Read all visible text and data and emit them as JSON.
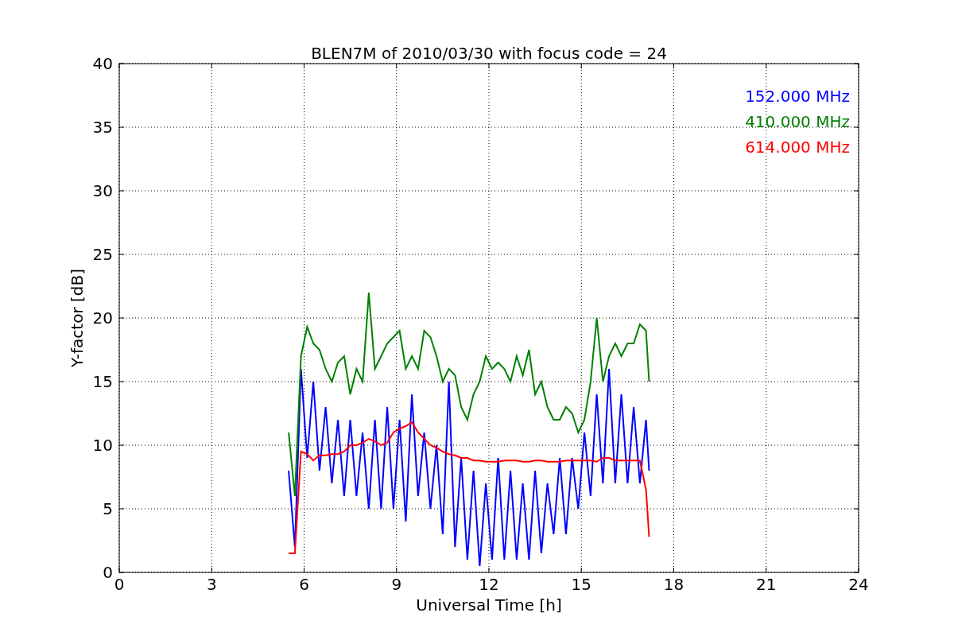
{
  "figure": {
    "chart_data": {
      "type": "line",
      "title": "BLEN7M of 2010/03/30 with focus code = 24",
      "xlabel": "Universal Time [h]",
      "ylabel": "Y-factor [dB]",
      "x": [
        5.5,
        5.7,
        5.9,
        6.1,
        6.3,
        6.5,
        6.7,
        6.9,
        7.1,
        7.3,
        7.5,
        7.7,
        7.9,
        8.1,
        8.3,
        8.5,
        8.7,
        8.9,
        9.1,
        9.3,
        9.5,
        9.7,
        9.9,
        10.1,
        10.3,
        10.5,
        10.7,
        10.9,
        11.1,
        11.3,
        11.5,
        11.7,
        11.9,
        12.1,
        12.3,
        12.5,
        12.7,
        12.9,
        13.1,
        13.3,
        13.5,
        13.7,
        13.9,
        14.1,
        14.3,
        14.5,
        14.7,
        14.9,
        15.1,
        15.3,
        15.5,
        15.7,
        15.9,
        16.1,
        16.3,
        16.5,
        16.7,
        16.9,
        17.1,
        17.2
      ],
      "series": [
        {
          "name": "152.000 MHz",
          "color": "#0000ff",
          "values": [
            8,
            2,
            16,
            9,
            15,
            8,
            13,
            7,
            12,
            6,
            12,
            6,
            11,
            5,
            12,
            5,
            13,
            5,
            12,
            4,
            14,
            6,
            11,
            5,
            10,
            3,
            15,
            2,
            9,
            1,
            8,
            0.5,
            7,
            1,
            9,
            1,
            8,
            1,
            7,
            1,
            8,
            1.5,
            7,
            3,
            9,
            3,
            9,
            5,
            11,
            6,
            14,
            7,
            16,
            7,
            14,
            7,
            13,
            7,
            12,
            8
          ]
        },
        {
          "name": "410.000 MHz",
          "color": "#008000",
          "values": [
            11,
            6,
            17,
            19.3,
            18,
            17.5,
            16,
            15,
            16.5,
            17,
            14,
            16,
            15,
            22,
            16,
            17,
            18,
            18.5,
            19,
            16,
            17,
            16,
            19,
            18.5,
            17,
            15,
            16,
            15.5,
            13,
            12,
            14,
            15,
            17,
            16,
            16.5,
            16,
            15,
            17,
            15.5,
            17.5,
            14,
            15,
            13,
            12,
            12,
            13,
            12.5,
            11,
            12,
            15,
            20,
            15,
            17,
            18,
            17,
            18,
            18,
            19.5,
            19,
            15
          ]
        },
        {
          "name": "614.000 MHz",
          "color": "#ff0000",
          "values": [
            1.5,
            1.5,
            9.5,
            9.3,
            8.8,
            9.2,
            9.2,
            9.3,
            9.3,
            9.5,
            10,
            10,
            10.2,
            10.5,
            10.3,
            10,
            10.2,
            11,
            11.3,
            11.5,
            11.8,
            11,
            10.5,
            10,
            9.8,
            9.5,
            9.3,
            9.2,
            9,
            9,
            8.8,
            8.8,
            8.7,
            8.7,
            8.7,
            8.8,
            8.8,
            8.8,
            8.7,
            8.7,
            8.8,
            8.8,
            8.7,
            8.7,
            8.7,
            8.8,
            8.8,
            8.8,
            8.8,
            8.8,
            8.7,
            9,
            9,
            8.8,
            8.8,
            8.8,
            8.8,
            8.8,
            6.5,
            2.8
          ]
        }
      ],
      "grid": true,
      "xlim": [
        0,
        24
      ],
      "ylim": [
        0,
        40
      ],
      "xticks": [
        0,
        3,
        6,
        9,
        12,
        15,
        18,
        21,
        24
      ],
      "yticks": [
        0,
        5,
        10,
        15,
        20,
        25,
        30,
        35,
        40
      ]
    }
  }
}
